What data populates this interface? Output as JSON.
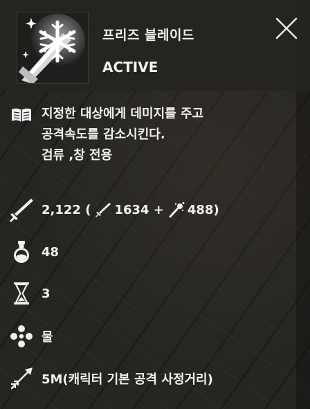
{
  "skill": {
    "name": "프리즈 블레이드",
    "type": "ACTIVE",
    "icon": "freeze-blade-snowflake-icon"
  },
  "description": {
    "lines": [
      "지정한 대상에게 데미지를 주고",
      "공격속도를 감소시킨다.",
      "검류 ,창 전용"
    ],
    "icon": "book-icon"
  },
  "damage": {
    "total": "2,122 (",
    "physical": "1634 +",
    "magic": "488)",
    "icon": "sword-icon",
    "physical_icon": "sword-icon",
    "magic_icon": "magic-wand-icon"
  },
  "mp_cost": {
    "value": "48",
    "icon": "potion-icon"
  },
  "cooldown": {
    "value": "3",
    "icon": "hourglass-icon"
  },
  "element": {
    "value": "물",
    "icon": "water-element-icon"
  },
  "range": {
    "value": "5M(캐릭터 기본 공격 사정거리)",
    "icon": "range-arrow-icon"
  },
  "colors": {
    "text": "#f2f2f2",
    "header_bg": "#262420",
    "icon_frame": "#1d1d1c"
  }
}
